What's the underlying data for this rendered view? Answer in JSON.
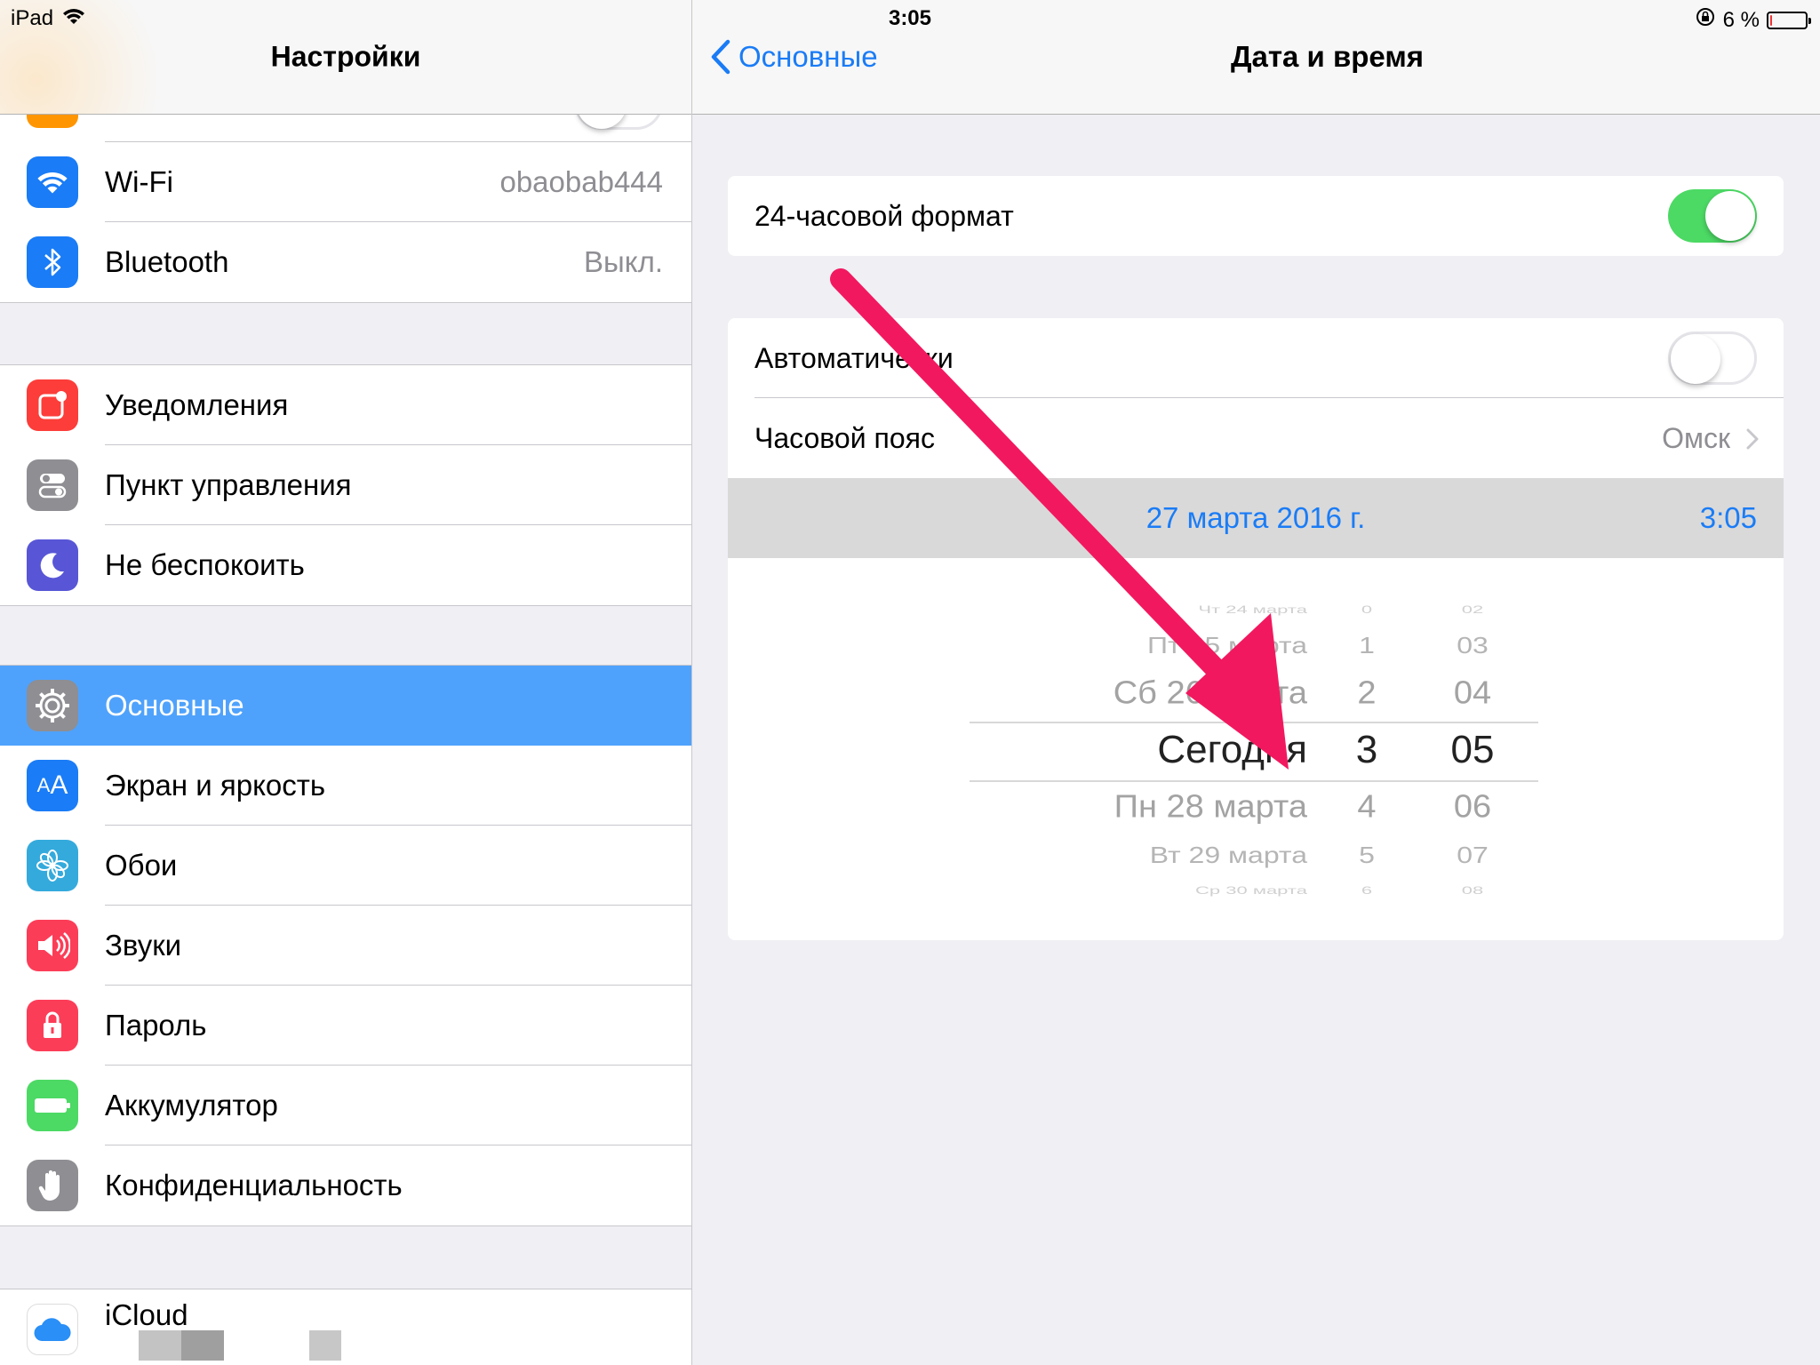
{
  "status_bar": {
    "device": "iPad",
    "time": "3:05",
    "battery_percent": "6 %",
    "battery_level": 0.06
  },
  "sidebar": {
    "title": "Настройки",
    "groups": [
      {
        "items": [
          {
            "label": "Wi-Fi",
            "value": "obaobab444",
            "icon": "wifi-icon",
            "color": "#1a7cf6"
          },
          {
            "label": "Bluetooth",
            "value": "Выкл.",
            "icon": "bluetooth-icon",
            "color": "#1a7cf6"
          }
        ]
      },
      {
        "items": [
          {
            "label": "Уведомления",
            "icon": "notifications-icon",
            "color": "#fc3d39"
          },
          {
            "label": "Пункт управления",
            "icon": "control-center-icon",
            "color": "#8e8e93"
          },
          {
            "label": "Не беспокоить",
            "icon": "moon-icon",
            "color": "#5856d6"
          }
        ]
      },
      {
        "items": [
          {
            "label": "Основные",
            "icon": "gear-icon",
            "color": "#8e8e93",
            "selected": true
          },
          {
            "label": "Экран и яркость",
            "icon": "display-brightness-icon",
            "color": "#1a7cf6"
          },
          {
            "label": "Обои",
            "icon": "wallpaper-flower-icon",
            "color": "#34aadc"
          },
          {
            "label": "Звуки",
            "icon": "speaker-icon",
            "color": "#fc3d58"
          },
          {
            "label": "Пароль",
            "icon": "lock-icon",
            "color": "#fc3d58"
          },
          {
            "label": "Аккумулятор",
            "icon": "battery-icon",
            "color": "#4cd964"
          },
          {
            "label": "Конфиденциальность",
            "icon": "hand-icon",
            "color": "#8e8e93"
          }
        ]
      },
      {
        "items": [
          {
            "label": "iCloud",
            "icon": "cloud-icon",
            "color": "#1a7cf6"
          }
        ]
      }
    ]
  },
  "detail": {
    "back_label": "Основные",
    "title": "Дата и время",
    "format_24h": {
      "label": "24-часовой формат",
      "on": true
    },
    "automatic": {
      "label": "Автоматически",
      "on": false
    },
    "timezone": {
      "label": "Часовой пояс",
      "value": "Омск"
    },
    "selected_date": "27 марта 2016 г.",
    "selected_time": "3:05",
    "picker": {
      "dates": [
        "Чт 24 марта",
        "Пт 25 марта",
        "Сб 26 марта",
        "Сегодня",
        "Пн 28 марта",
        "Вт 29 марта",
        "Ср 30 марта"
      ],
      "hours": [
        "0",
        "1",
        "2",
        "3",
        "4",
        "5",
        "6"
      ],
      "minutes": [
        "02",
        "03",
        "04",
        "05",
        "06",
        "07",
        "08"
      ]
    }
  },
  "colors": {
    "accent": "#1a7cf6",
    "selected_row": "#4fa2fb",
    "toggle_on": "#4cd964",
    "annotation_arrow": "#f2185f"
  }
}
